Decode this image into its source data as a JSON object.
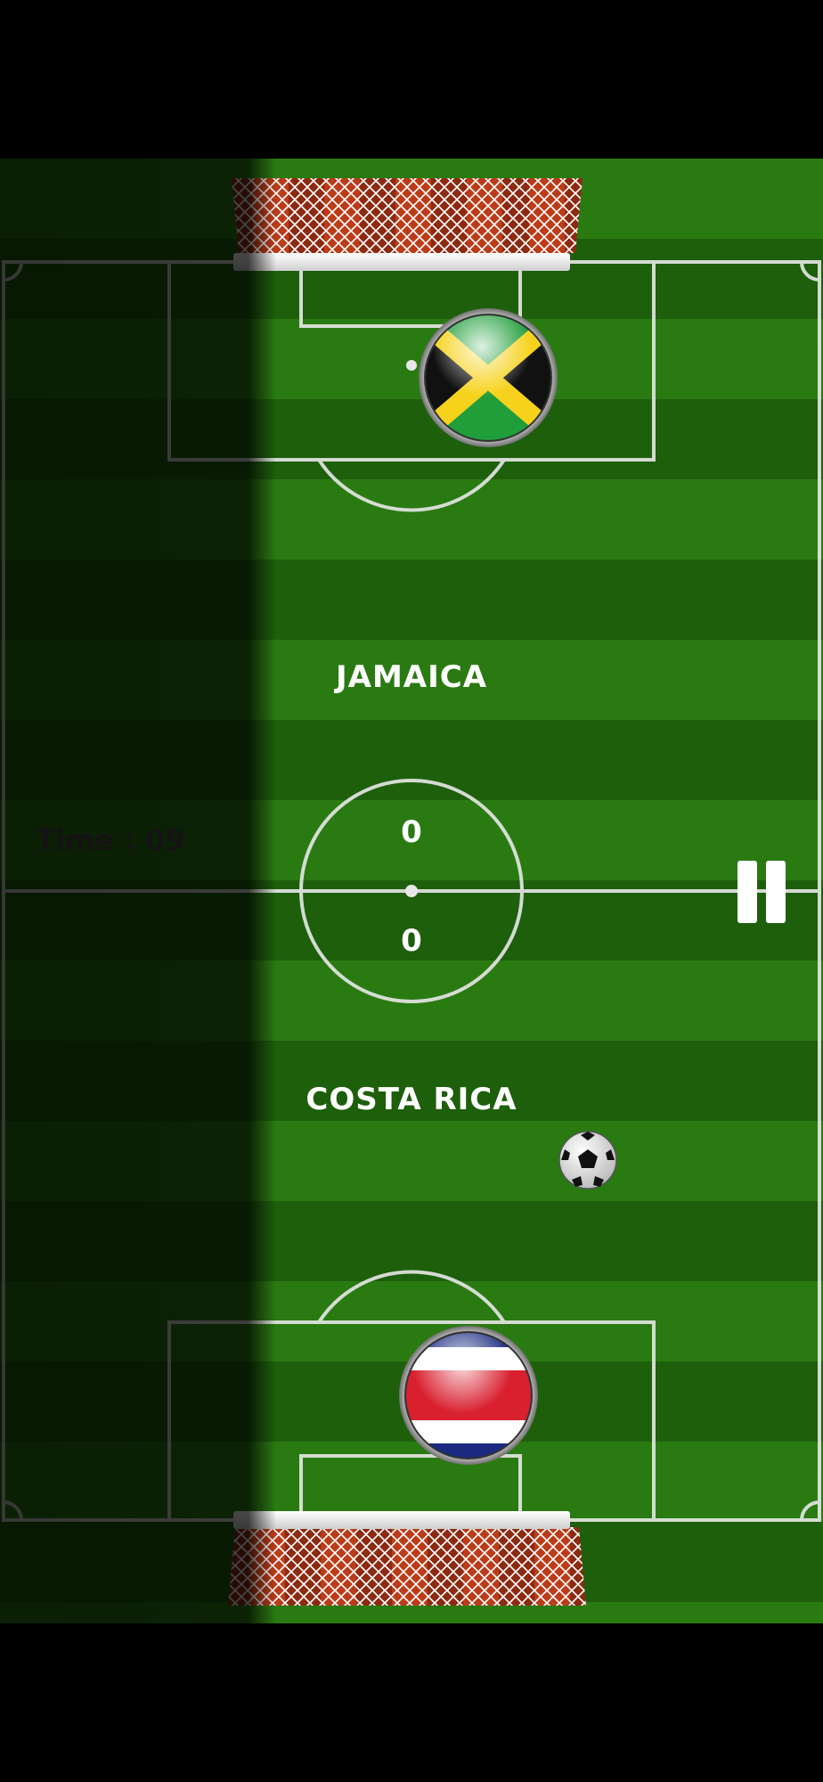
{
  "match": {
    "home_team": "JAMAICA",
    "away_team": "COSTA RICA",
    "home_score": "0",
    "away_score": "0",
    "timer_text": "Time : 09"
  },
  "controls": {
    "pause_icon": "pause-icon"
  },
  "colors": {
    "pitch_light": "#2a7a12",
    "pitch_dark": "#1d5f0b",
    "lines": "#e8e8e8",
    "net_red": "#c0391a",
    "jamaica_green": "#1f9e3a",
    "jamaica_gold": "#f6d21c",
    "costa_rica_red": "#d8202f",
    "costa_rica_blue": "#1b2a80"
  }
}
